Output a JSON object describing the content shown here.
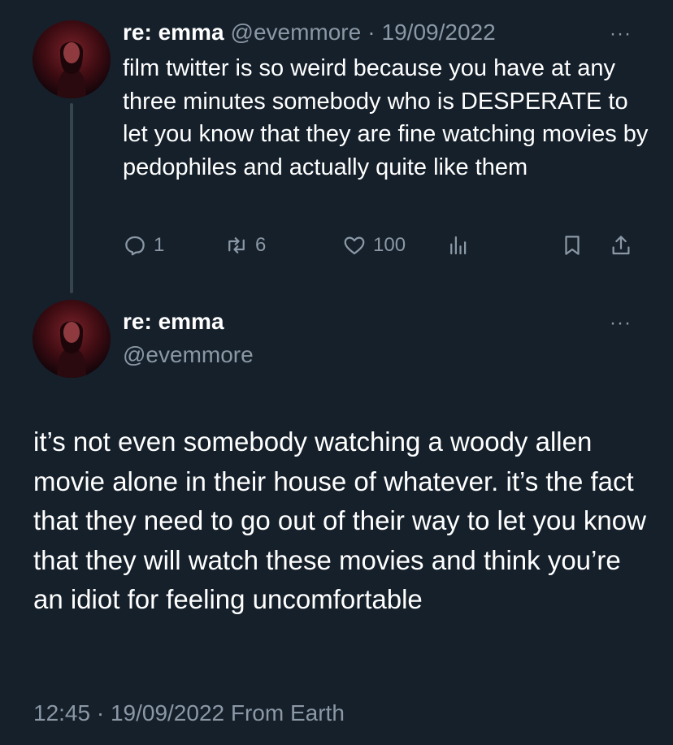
{
  "tweet1": {
    "display_name": "re: emma",
    "handle": "@evemmore",
    "separator": "·",
    "date": "19/09/2022",
    "more_label": "···",
    "text": "film twitter is so weird because you have at any three minutes somebody who is DESPERATE to let you know that they are fine watching movies by pedophiles and actually quite like them",
    "actions": {
      "replies": "1",
      "retweets": "6",
      "likes": "100"
    },
    "icons": [
      "reply-icon",
      "retweet-icon",
      "like-icon",
      "analytics-icon",
      "bookmark-icon",
      "share-icon"
    ]
  },
  "tweet2": {
    "display_name": "re: emma",
    "handle": "@evemmore",
    "more_label": "···",
    "text": "it’s not even somebody watching a woody allen movie alone in their house of whatever. it’s the fact that they need to go out of their way to let you know that they will watch these movies and think you’re an idiot for feeling uncomfortable",
    "footer": "12:45 · 19/09/2022 From Earth"
  },
  "colors": {
    "background": "#15202b",
    "text_primary": "#ffffff",
    "text_secondary": "#8b98a5",
    "thread_line": "#38444d"
  }
}
